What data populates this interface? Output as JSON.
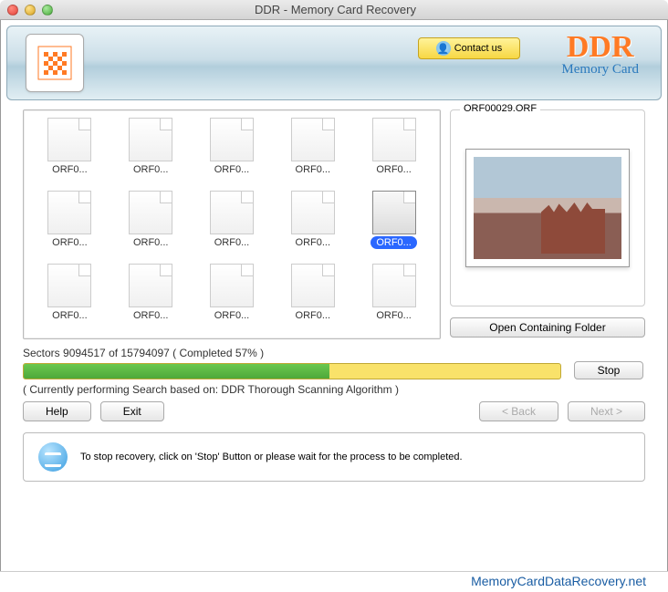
{
  "titlebar": {
    "title": "DDR - Memory Card Recovery"
  },
  "header": {
    "contact_label": "Contact us",
    "brand_title": "DDR",
    "brand_sub": "Memory Card"
  },
  "preview": {
    "legend": "ORF00029.ORF",
    "open_button": "Open Containing Folder"
  },
  "files": [
    {
      "name": "ORF0...",
      "selected": false
    },
    {
      "name": "ORF0...",
      "selected": false
    },
    {
      "name": "ORF0...",
      "selected": false
    },
    {
      "name": "ORF0...",
      "selected": false
    },
    {
      "name": "ORF0...",
      "selected": false
    },
    {
      "name": "ORF0...",
      "selected": false
    },
    {
      "name": "ORF0...",
      "selected": false
    },
    {
      "name": "ORF0...",
      "selected": false
    },
    {
      "name": "ORF0...",
      "selected": false
    },
    {
      "name": "ORF0...",
      "selected": true
    },
    {
      "name": "ORF0...",
      "selected": false
    },
    {
      "name": "ORF0...",
      "selected": false
    },
    {
      "name": "ORF0...",
      "selected": false
    },
    {
      "name": "ORF0...",
      "selected": false
    },
    {
      "name": "ORF0...",
      "selected": false
    }
  ],
  "progress": {
    "current": 9094517,
    "total": 15794097,
    "percent": 57,
    "text": "Sectors 9094517 of 15794097   ( Completed 57% )",
    "algorithm": "( Currently performing Search based on: DDR Thorough Scanning Algorithm )",
    "stop_label": "Stop"
  },
  "nav": {
    "help": "Help",
    "exit": "Exit",
    "back": "< Back",
    "next": "Next >"
  },
  "info": {
    "message": "To stop recovery, click on 'Stop' Button or please wait for the process to be completed."
  },
  "footer": {
    "url": "MemoryCardDataRecovery.net"
  }
}
